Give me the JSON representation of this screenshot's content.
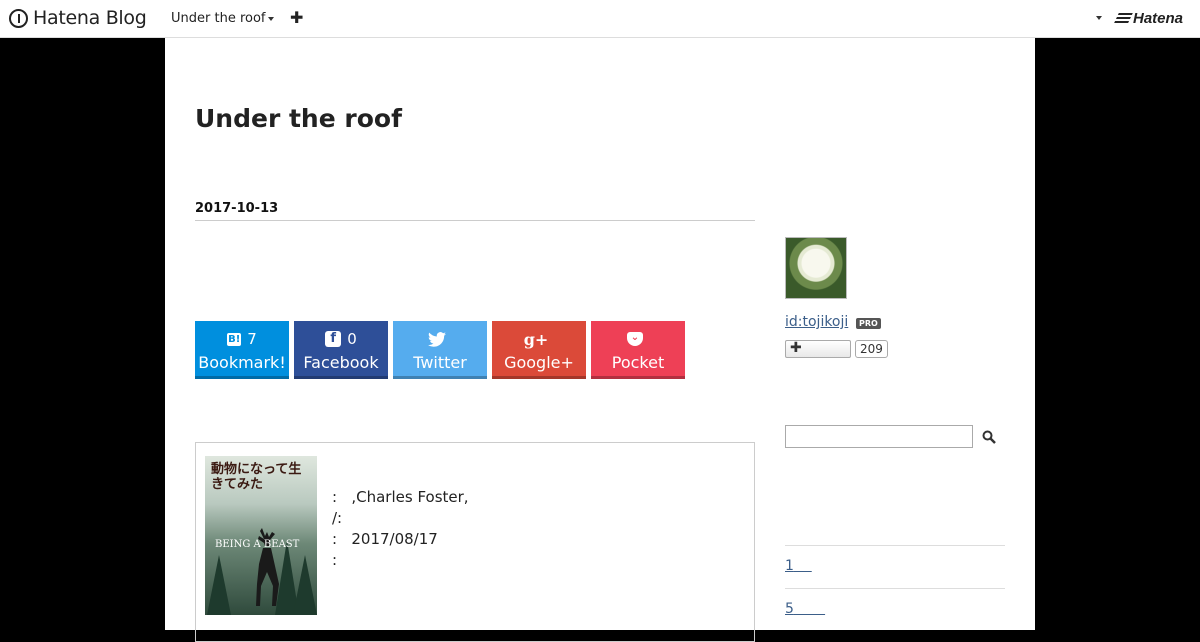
{
  "header": {
    "logo_text": "Hatena Blog",
    "blog_switch_label": "Under the roof",
    "add_label": "✚",
    "brand_text": "Hatena"
  },
  "blog": {
    "title": "Under the roof"
  },
  "entry": {
    "date": "2017-10-13"
  },
  "share": [
    {
      "count": "7",
      "label": "Bookmark!",
      "color": "#008fde"
    },
    {
      "count": "0",
      "label": "Facebook",
      "color": "#2e4f98"
    },
    {
      "count": "",
      "label": "Twitter",
      "color": "#55acee"
    },
    {
      "count": "",
      "label": "Google+",
      "color": "#db4a39"
    },
    {
      "count": "",
      "label": "Pocket",
      "color": "#ee4056"
    }
  ],
  "book": {
    "cover_title": "動物になって生きてみた",
    "cover_subtitle": "BEING A BEAST",
    "info_lines": [
      ":   ,Charles Foster,",
      "/:",
      ":   2017/08/17",
      ":"
    ]
  },
  "sidebar": {
    "user_id": "id:tojikoji",
    "pro_badge": "PRO",
    "follow_label": "✚",
    "follower_count": "209",
    "links": [
      "",
      "1",
      "5"
    ]
  }
}
